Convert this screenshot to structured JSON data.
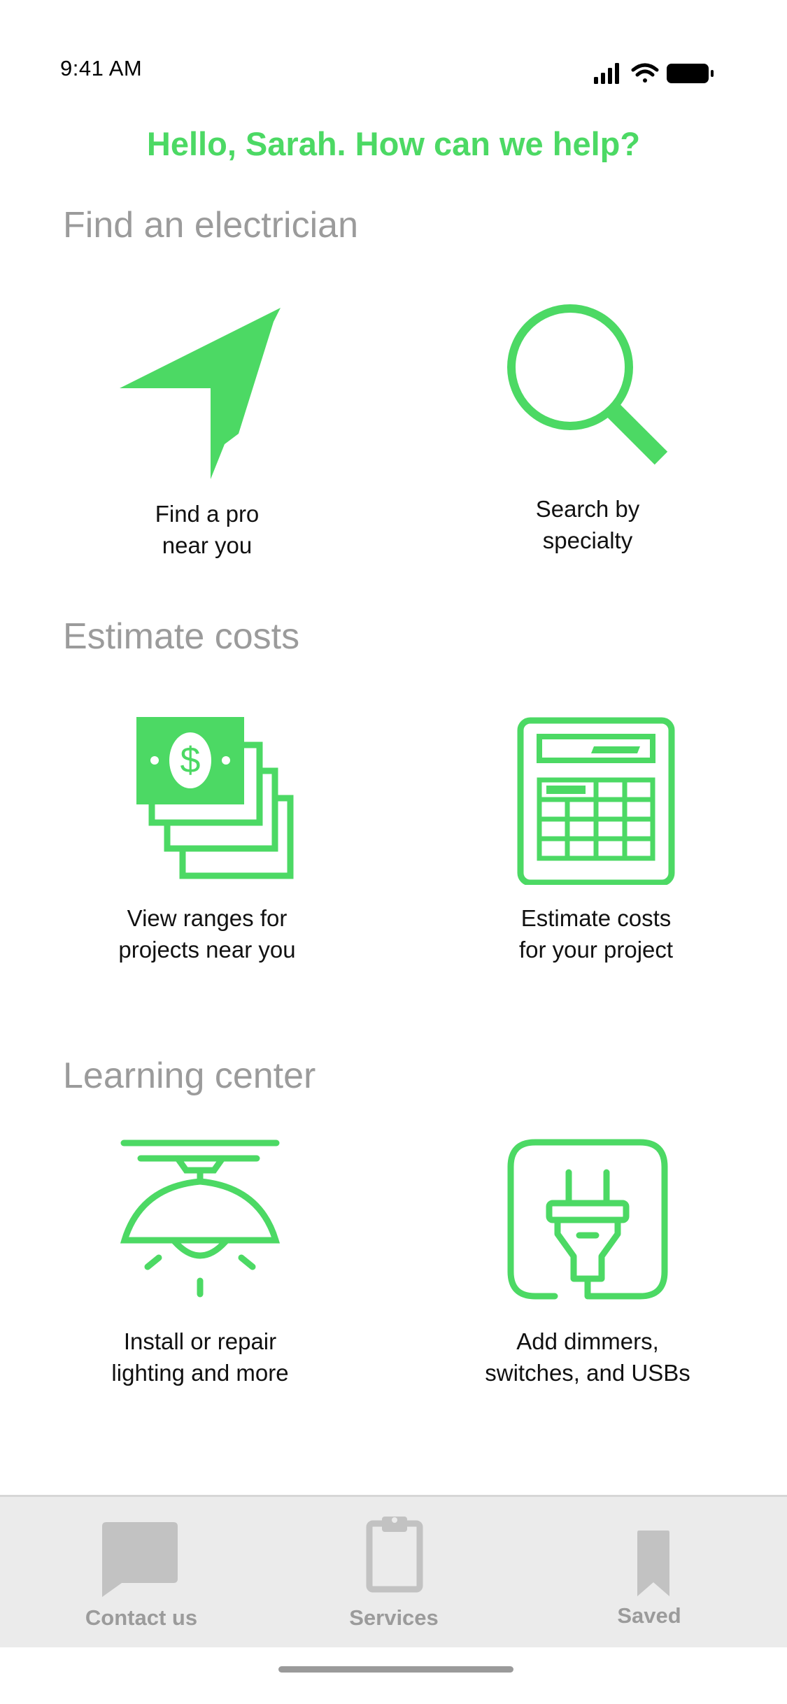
{
  "status": {
    "time": "9:41 AM"
  },
  "greeting": "Hello, Sarah. How can we help?",
  "sections": {
    "find": {
      "title": "Find an electrician",
      "items": [
        {
          "label": "Find a pro\nnear you",
          "icon": "location-arrow-icon"
        },
        {
          "label": "Search by\nspecialty",
          "icon": "magnifier-icon"
        }
      ]
    },
    "estimate": {
      "title": "Estimate costs",
      "items": [
        {
          "label": "View ranges for\nprojects near you",
          "icon": "money-stack-icon"
        },
        {
          "label": "Estimate costs\nfor your project",
          "icon": "calculator-icon"
        }
      ]
    },
    "learning": {
      "title": "Learning center",
      "items": [
        {
          "label": "Install or repair\nlighting and more",
          "icon": "ceiling-lamp-icon"
        },
        {
          "label": "Add dimmers,\nswitches, and USBs",
          "icon": "power-plug-icon"
        }
      ]
    }
  },
  "tabbar": {
    "items": [
      {
        "label": "Contact us",
        "icon": "chat-bubble-icon"
      },
      {
        "label": "Services",
        "icon": "clipboard-icon"
      },
      {
        "label": "Saved",
        "icon": "bookmark-icon"
      }
    ]
  },
  "colors": {
    "accent": "#4cd964",
    "section_title": "#9b9b9b",
    "tab_inactive": "#9b9b9b",
    "tabbar_bg": "#ebebeb"
  }
}
